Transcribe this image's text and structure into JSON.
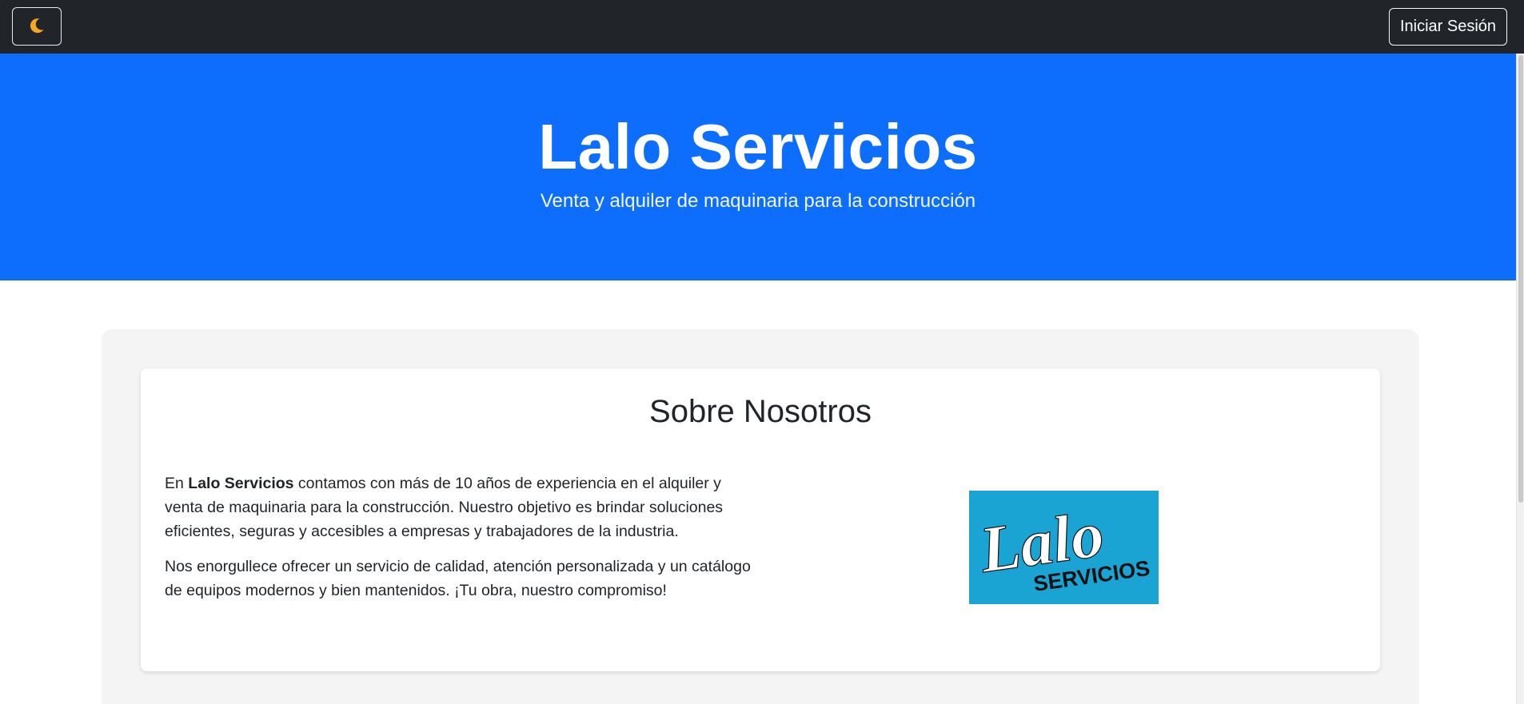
{
  "navbar": {
    "theme_toggle_icon": "moon-icon",
    "login_label": "Iniciar Sesión"
  },
  "hero": {
    "title": "Lalo Servicios",
    "subtitle": "Venta y alquiler de maquinaria para la construcción"
  },
  "about": {
    "title": "Sobre Nosotros",
    "p1_prefix": "En ",
    "p1_brand": "Lalo Servicios",
    "p1_rest": " contamos con más de 10 años de experiencia en el alquiler y venta de maquinaria para la construcción. Nuestro objetivo es brindar soluciones eficientes, seguras y accesibles a empresas y trabajadores de la industria.",
    "p2": "Nos enorgullece ofrecer un servicio de calidad, atención personalizada y un catálogo de equipos modernos y bien mantenidos. ¡Tu obra, nuestro compromiso!",
    "logo_text_main": "Lalo",
    "logo_text_sub": "SERVICIOS"
  },
  "colors": {
    "navbar_bg": "#212529",
    "hero_bg": "#0d6efd",
    "moon": "#f5a623",
    "logo_bg": "#1aa4d3"
  }
}
